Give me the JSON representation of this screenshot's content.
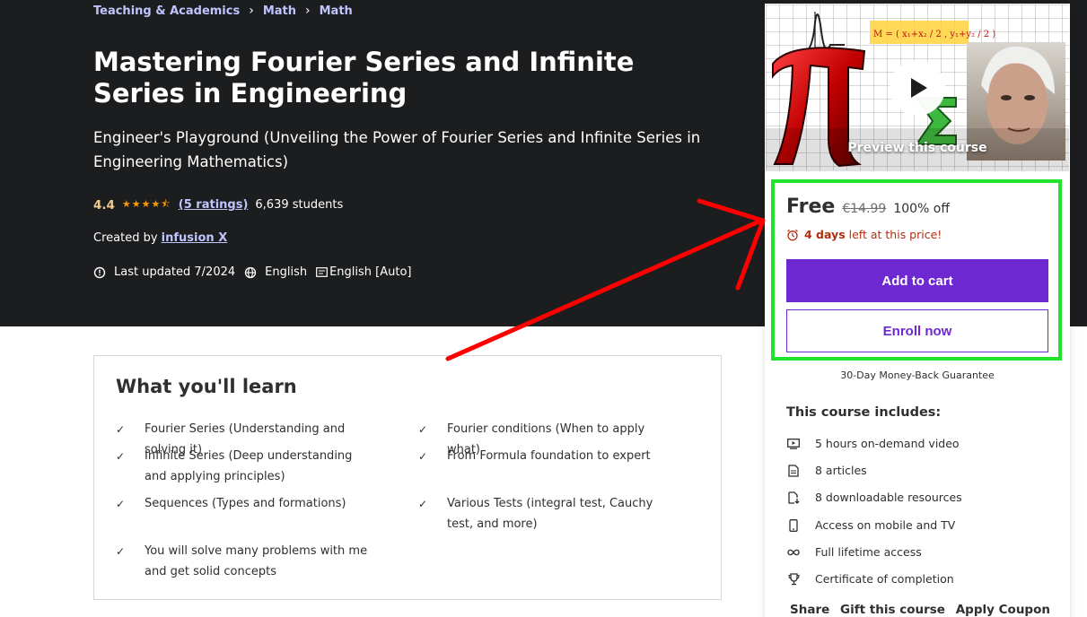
{
  "breadcrumb": [
    {
      "label": "Teaching & Academics"
    },
    {
      "label": "Math"
    },
    {
      "label": "Math"
    }
  ],
  "course": {
    "title": "Mastering Fourier Series and Infinite Series in Engineering",
    "subtitle": "Engineer's Playground (Unveiling the Power of Fourier Series and Infinite Series in Engineering Mathematics)",
    "rating": "4.4",
    "stars": 4.4,
    "ratings_count": "(5 ratings)",
    "students": "6,639 students",
    "created_by_prefix": "Created by",
    "instructor": "infusion X",
    "last_updated": "Last updated 7/2024",
    "language": "English",
    "captions": "English [Auto]"
  },
  "learn": {
    "title": "What you'll learn",
    "items": [
      "Fourier Series (Understanding and solving it)",
      "Fourier conditions (When to apply what)",
      "Infinite Series (Deep understanding and applying principles)",
      "From Formula foundation to expert",
      "Sequences (Types and formations)",
      "Various Tests (integral test, Cauchy test, and more)",
      "You will solve many problems with me and get solid concepts"
    ]
  },
  "preview": {
    "label": "Preview this course",
    "formula": "M = ( x₁+x₂ / 2 , y₁+y₂ / 2 )"
  },
  "pricing": {
    "current": "Free",
    "original": "€14.99",
    "discount": "100% off",
    "timer_bold": "4 days",
    "timer_rest": "left at this price!",
    "add_to_cart": "Add to cart",
    "enroll_now": "Enroll now",
    "guarantee": "30-Day Money-Back Guarantee"
  },
  "includes": {
    "title": "This course includes:",
    "items": [
      {
        "icon": "video-icon",
        "label": "5 hours on-demand video"
      },
      {
        "icon": "article-icon",
        "label": "8 articles"
      },
      {
        "icon": "download-file-icon",
        "label": "8 downloadable resources"
      },
      {
        "icon": "mobile-icon",
        "label": "Access on mobile and TV"
      },
      {
        "icon": "infinity-icon",
        "label": "Full lifetime access"
      },
      {
        "icon": "trophy-icon",
        "label": "Certificate of completion"
      }
    ]
  },
  "actions": {
    "share": "Share",
    "gift": "Gift this course",
    "coupon": "Apply Coupon"
  },
  "colors": {
    "hero_bg": "#1c1d1f",
    "accent": "#6d28d2",
    "link": "#c0c4fc",
    "star": "#f69c08",
    "rating": "#f3ca8c",
    "highlight": "#22e32c",
    "arrow": "#ff0000",
    "timer": "#b32d0f"
  }
}
